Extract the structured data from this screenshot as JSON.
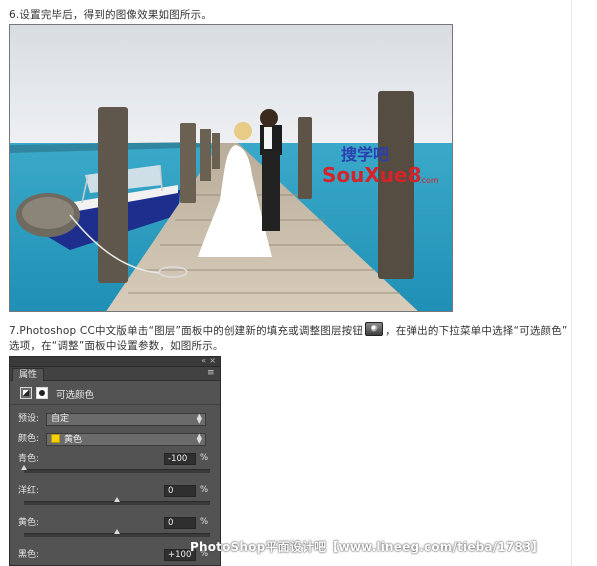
{
  "article": {
    "step6": "6.设置完毕后，得到的图像效果如图所示。",
    "step7_before_button": "7.Photoshop CC中文版单击“图层”面板中的创建新的填充或调整图层按钮",
    "step7_after_button": "，在弹出的下拉菜单中选择“可选颜色”",
    "step7_line2": "选项，在“调整”面板中设置参数，如图所示。"
  },
  "photo_logo": {
    "top": "搜学吧",
    "main": "SouXue8",
    "suffix": ".com"
  },
  "panel": {
    "collapse_icon": "«",
    "close_icon": "×",
    "tab_label": "属性",
    "menu_icon": "≡",
    "title": "可选颜色",
    "preset_label": "预设:",
    "preset_value": "自定",
    "color_label": "颜色:",
    "color_value": "黄色",
    "color_swatch": "#f5d000",
    "sliders": [
      {
        "label": "青色:",
        "value": "-100",
        "unit": "%",
        "percent": -100
      },
      {
        "label": "洋红:",
        "value": "0",
        "unit": "%",
        "percent": 0
      },
      {
        "label": "黄色:",
        "value": "0",
        "unit": "%",
        "percent": 0
      },
      {
        "label": "黑色:",
        "value": "+100",
        "unit": "%",
        "percent": 100
      }
    ]
  },
  "watermark": "PhotoShop平面设计吧【www.lineeg.com/tieba/1783】"
}
